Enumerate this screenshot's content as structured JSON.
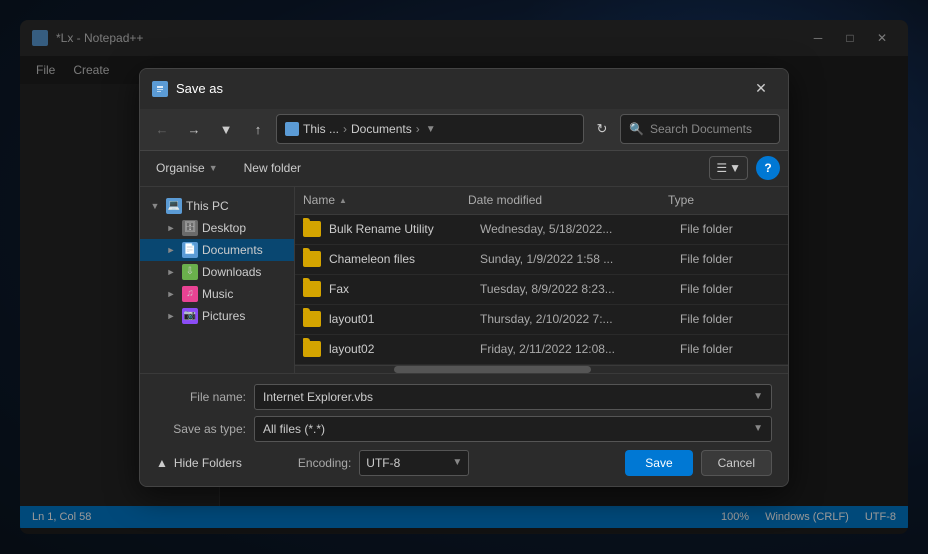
{
  "background": {
    "color": "#0d1a2e"
  },
  "editor": {
    "title": "*L",
    "titlebar_full": "*Lx - Notepad++",
    "menu_items": [
      "File",
      "Create"
    ],
    "statusbar": {
      "position": "Ln 1, Col 58",
      "zoom": "100%",
      "line_ending": "Windows (CRLF)",
      "encoding": "UTF-8"
    }
  },
  "dialog": {
    "title": "Save as",
    "close_label": "✕",
    "navbar": {
      "back_tooltip": "Back",
      "forward_tooltip": "Forward",
      "dropdown_tooltip": "Recent locations",
      "up_tooltip": "Up",
      "path": {
        "icon_label": "Documents",
        "segments": [
          "This ...",
          "Documents"
        ],
        "dropdown_arrow": "▾"
      },
      "refresh_tooltip": "Refresh",
      "search_placeholder": "Search Documents"
    },
    "toolbar": {
      "organise_label": "Organise",
      "new_folder_label": "New folder",
      "view_icon": "☰",
      "view_arrow": "▾",
      "help_label": "?"
    },
    "sidebar": {
      "items": [
        {
          "id": "this-pc",
          "label": "This PC",
          "icon_type": "pc",
          "expanded": true,
          "indent": 0,
          "expand_arrow": "▼"
        },
        {
          "id": "desktop",
          "label": "Desktop",
          "icon_type": "desktop",
          "indent": 1,
          "expand_arrow": "▶"
        },
        {
          "id": "documents",
          "label": "Documents",
          "icon_type": "documents",
          "indent": 1,
          "expand_arrow": "▶",
          "active": true
        },
        {
          "id": "downloads",
          "label": "Downloads",
          "icon_type": "downloads",
          "indent": 1,
          "expand_arrow": "▶"
        },
        {
          "id": "music",
          "label": "Music",
          "icon_type": "music",
          "indent": 1,
          "expand_arrow": "▶"
        },
        {
          "id": "pictures",
          "label": "Pictures",
          "icon_type": "pictures",
          "indent": 1,
          "expand_arrow": "▶"
        }
      ]
    },
    "filelist": {
      "headers": [
        "Name",
        "Date modified",
        "Type"
      ],
      "files": [
        {
          "name": "Bulk Rename Utility",
          "date": "Wednesday, 5/18/2022...",
          "type": "File folder"
        },
        {
          "name": "Chameleon files",
          "date": "Sunday, 1/9/2022 1:58 ...",
          "type": "File folder"
        },
        {
          "name": "Fax",
          "date": "Tuesday, 8/9/2022 8:23...",
          "type": "File folder"
        },
        {
          "name": "layout01",
          "date": "Thursday, 2/10/2022 7:...",
          "type": "File folder"
        },
        {
          "name": "layout02",
          "date": "Friday, 2/11/2022 12:08...",
          "type": "File folder"
        }
      ]
    },
    "form": {
      "filename_label": "File name:",
      "filename_value": "Internet Explorer.vbs",
      "savetype_label": "Save as type:",
      "savetype_value": "All files  (*.*)",
      "encoding_label": "Encoding:",
      "encoding_value": "UTF-8",
      "hide_folders_label": "Hide Folders",
      "save_label": "Save",
      "cancel_label": "Cancel"
    }
  }
}
